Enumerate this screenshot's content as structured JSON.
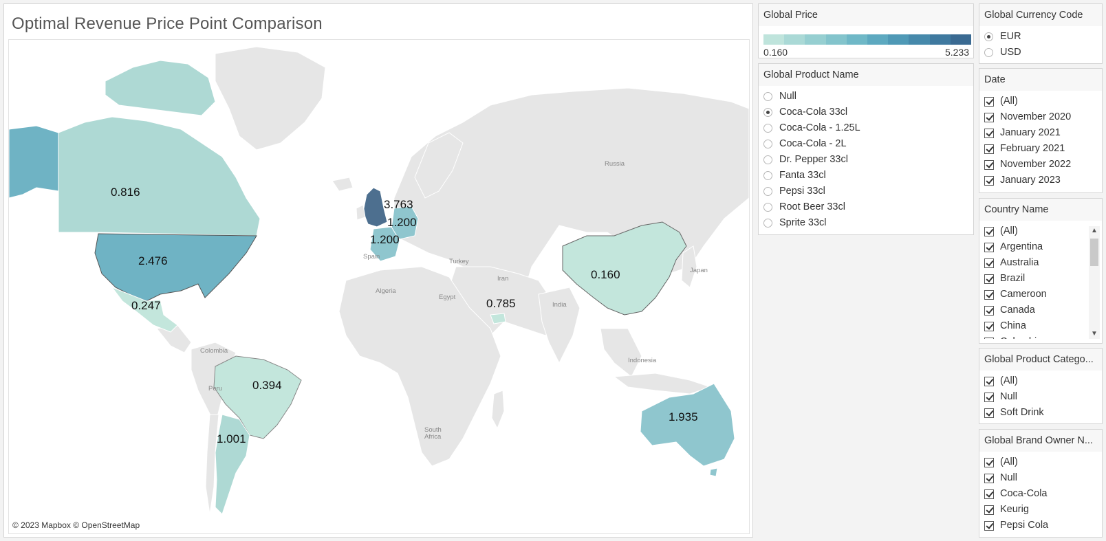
{
  "title": "Optimal Revenue Price Point Comparison",
  "attribution": "© 2023 Mapbox © OpenStreetMap",
  "legend": {
    "title": "Global Price",
    "min": "0.160",
    "max": "5.233",
    "colors": [
      "#bfe4dc",
      "#aad9d6",
      "#96cfd1",
      "#83c4cc",
      "#6fb8c7",
      "#5da9c0",
      "#4f99b6",
      "#4689ab",
      "#3f799f",
      "#3a6a92"
    ]
  },
  "regions": {
    "canada": "0.816",
    "usa": "2.476",
    "mexico": "0.247",
    "brazil": "0.394",
    "argentina": "1.001",
    "uk": "3.763",
    "germany": "1.200",
    "france": "1.200",
    "uae": "0.785",
    "china": "0.160",
    "australia": "1.935"
  },
  "map_labels": {
    "russia": "Russia",
    "spain": "Spain",
    "turkey": "Turkey",
    "iran": "Iran",
    "algeria": "Algeria",
    "egypt": "Egypt",
    "india": "India",
    "japan": "Japan",
    "indonesia": "Indonesia",
    "colombia": "Colombia",
    "peru": "Peru",
    "south_africa_1": "South",
    "south_africa_2": "Africa"
  },
  "product": {
    "title": "Global Product Name",
    "options": [
      "Null",
      "Coca-Cola 33cl",
      "Coca-Cola - 1.25L",
      "Coca-Cola - 2L",
      "Dr. Pepper 33cl",
      "Fanta 33cl",
      "Pepsi 33cl",
      "Root Beer 33cl",
      "Sprite 33cl"
    ],
    "selected": "Coca-Cola 33cl"
  },
  "currency": {
    "title": "Global Currency Code",
    "options": [
      "EUR",
      "USD"
    ],
    "selected": "EUR"
  },
  "date": {
    "title": "Date",
    "options": [
      "(All)",
      "November 2020",
      "January 2021",
      "February 2021",
      "November 2022",
      "January 2023"
    ]
  },
  "country": {
    "title": "Country Name",
    "options": [
      "(All)",
      "Argentina",
      "Australia",
      "Brazil",
      "Cameroon",
      "Canada",
      "China",
      "Colombia"
    ]
  },
  "category": {
    "title": "Global Product Catego...",
    "options": [
      "(All)",
      "Null",
      "Soft Drink"
    ]
  },
  "brand": {
    "title": "Global Brand Owner N...",
    "options": [
      "(All)",
      "Null",
      "Coca-Cola",
      "Keurig",
      "Pepsi Cola"
    ]
  }
}
